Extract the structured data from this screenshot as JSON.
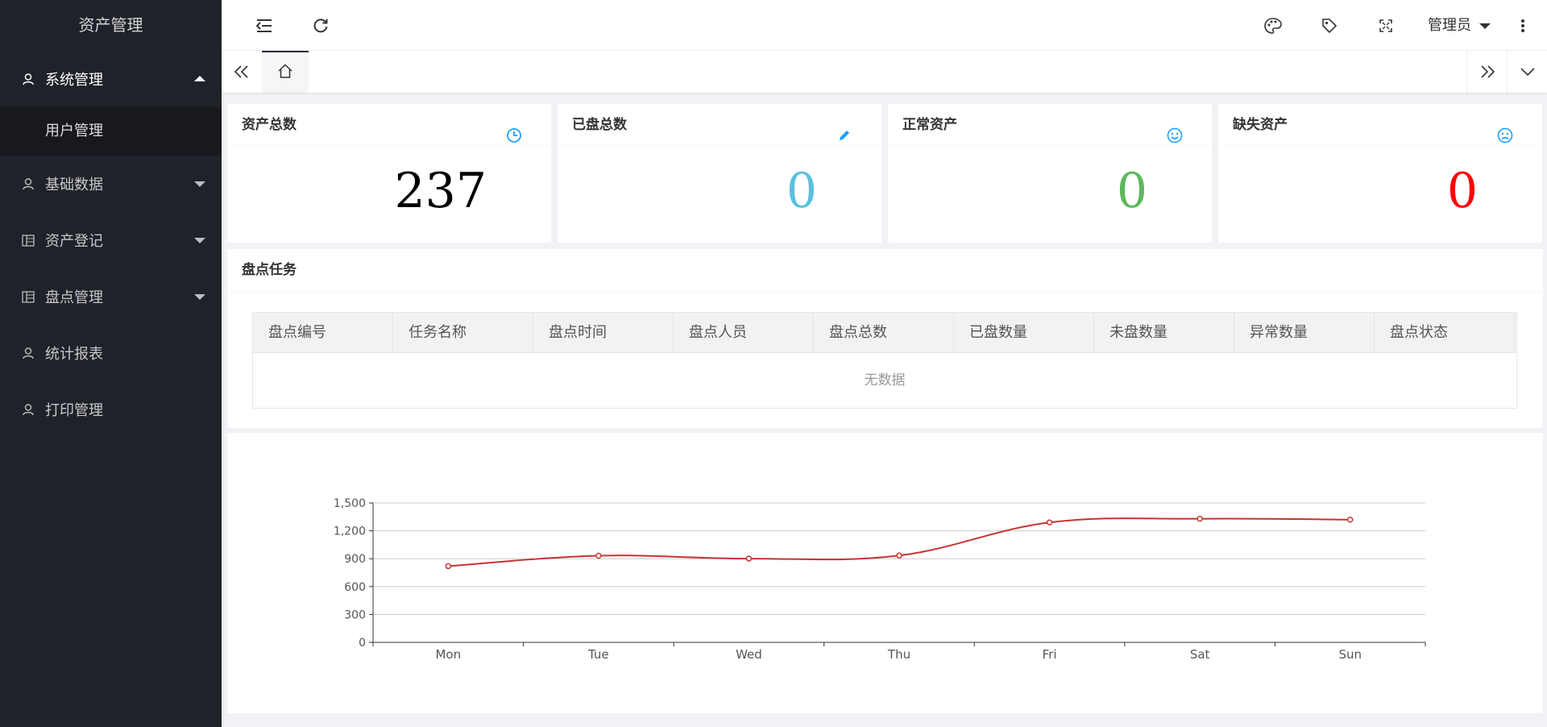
{
  "app": {
    "title": "资产管理"
  },
  "sidebar": {
    "items": [
      {
        "label": "系统管理",
        "icon": "user-icon",
        "expanded": true,
        "children": [
          {
            "label": "用户管理"
          }
        ]
      },
      {
        "label": "基础数据",
        "icon": "user-icon",
        "expanded": false
      },
      {
        "label": "资产登记",
        "icon": "table-icon",
        "expanded": false
      },
      {
        "label": "盘点管理",
        "icon": "table-icon",
        "expanded": false
      },
      {
        "label": "统计报表",
        "icon": "user-icon"
      },
      {
        "label": "打印管理",
        "icon": "user-icon"
      }
    ]
  },
  "header": {
    "user": "管理员",
    "icons": [
      "menu-fold-icon",
      "refresh-icon",
      "theme-icon",
      "tag-icon",
      "fullscreen-icon",
      "more-icon"
    ]
  },
  "stats": [
    {
      "title": "资产总数",
      "value": "237",
      "icon": "clock-icon",
      "color": "#000000"
    },
    {
      "title": "已盘总数",
      "value": "0",
      "icon": "edit-icon",
      "color": "#5bc0de"
    },
    {
      "title": "正常资产",
      "value": "0",
      "icon": "smile-icon",
      "color": "#5cb85c"
    },
    {
      "title": "缺失资产",
      "value": "0",
      "icon": "sad-icon",
      "color": "#ff0000"
    }
  ],
  "tasks": {
    "title": "盘点任务",
    "columns": [
      "盘点编号",
      "任务名称",
      "盘点时间",
      "盘点人员",
      "盘点总数",
      "已盘数量",
      "未盘数量",
      "异常数量",
      "盘点状态"
    ],
    "empty_text": "无数据"
  },
  "chart_data": {
    "type": "line",
    "categories": [
      "Mon",
      "Tue",
      "Wed",
      "Thu",
      "Fri",
      "Sat",
      "Sun"
    ],
    "series": [
      {
        "values": [
          820,
          932,
          901,
          934,
          1290,
          1330,
          1320
        ]
      }
    ],
    "ylim": [
      0,
      1500
    ],
    "yticks": [
      "0",
      "300",
      "600",
      "900",
      "1,200",
      "1,500"
    ],
    "grid": true,
    "colors": {
      "line": "#c23531",
      "axis": "#333333",
      "grid": "#cccccc"
    }
  }
}
